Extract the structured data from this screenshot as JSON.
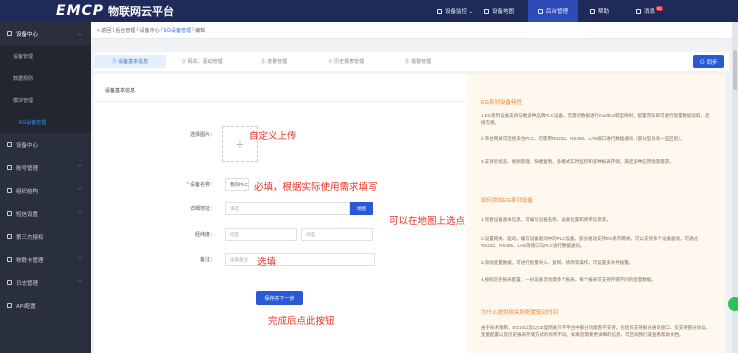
{
  "topbar": {
    "logo": "EMCP",
    "subtitle": "物联网云平台",
    "nav": [
      {
        "label": "设备监控 ⌄",
        "icon": "monitor-icon"
      },
      {
        "label": "设备地图",
        "icon": "map-icon"
      },
      {
        "label": "后台管理",
        "icon": "admin-icon"
      },
      {
        "label": "帮助",
        "icon": "help-icon"
      },
      {
        "label": "消息",
        "icon": "message-icon",
        "badge": "81"
      }
    ]
  },
  "sidebar": {
    "items": [
      {
        "label": "设备中心",
        "expanded": true
      },
      {
        "label": "设备管理",
        "sub": true
      },
      {
        "label": "数据规则",
        "sub": true
      },
      {
        "label": "模块管理",
        "sub": true
      },
      {
        "label": "EG设备管理",
        "sub": true,
        "active": true
      },
      {
        "label": "设备中心"
      },
      {
        "label": "账号管理"
      },
      {
        "label": "组织结构"
      },
      {
        "label": "短信设置"
      },
      {
        "label": "第三方授权"
      },
      {
        "label": "物联卡管理"
      },
      {
        "label": "日志管理"
      },
      {
        "label": "API配置"
      }
    ]
  },
  "breadcrumb": {
    "back": "< 返回",
    "parts": [
      "后台管理",
      "设备中心",
      "EG设备管理",
      "编辑"
    ]
  },
  "steps": [
    "① 设备基本信息",
    "② 网关、驱动管理",
    "③ 变量管理",
    "④ 历史报表管理",
    "⑤ 报警管理"
  ],
  "sync_button": "⊙ 同步",
  "form": {
    "title": "设备基本信息",
    "labels": {
      "image": "选择图片：",
      "name": "设备名称：",
      "address": "详细地址：",
      "coords": "经纬度：",
      "remark": "备注："
    },
    "required_mark": "*",
    "name_value": "我的PLC",
    "address_placeholder": "请选",
    "map_button": "地图",
    "lng_placeholder": "经度",
    "lat_placeholder": "纬度",
    "remark_placeholder": "设备备注",
    "submit": "保存并下一步",
    "upload_plus": "+"
  },
  "annotations": {
    "upload": "自定义上传",
    "name": "必填，根据实际使用需求填写",
    "map": "可以在地图上选点",
    "remark": "选填",
    "submit": "完成后点此按钮"
  },
  "info": {
    "h1": "EG系列设备特性",
    "p1": "1.EG系列设备支持与数多种品牌PLC设备，无需对数据进行modbus转型映射，配置完毕即可进行接量数据读取，连接方便。",
    "p2": "2.单台网关可连接多台PLC，可使用RS232、RS485、LAN端口进行数据通讯（部分型号有一些区别）。",
    "p3": "3.支持云组态、视频管理、快捷复制、多模式实时监控和多种报表存储，满足多种应用场景需求。",
    "h2": "如何添加EG系列设备",
    "q1": "1.完善设备基本信息，可编写设备名称，设备位置和简单信息等。",
    "q2": "2.设置网关、驱动，编写设备驱动中的PLC设备，部分驱动支持EG系列网关，可以支持多个设备驱动，可通过RS232、RS485、LAN等接口与PLC进行数据通讯。",
    "q3": "3.添加变量数据，可进行批量导入、复制、修改等操作，可设置多条件报警。",
    "q4": "4.按照历史报表配置，一份设备可创建多个报表，每个报表可支持存储不同的变量数据。",
    "h3": "为什么提供网关所配置驱动时间",
    "r1": "由于技术限制，EG10以及以CE型网关只不平台中部分功能暂不支持。包括仅支持部分通讯接口、仅支持部分协议、变量配置以及历史报表存储方式的有所不同。如果您需要更详细的信息，可咨询我们或查看帮助文档。"
  }
}
